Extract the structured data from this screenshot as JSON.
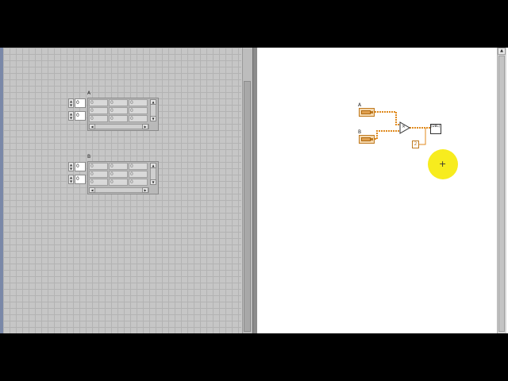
{
  "front_panel": {
    "arrays": [
      {
        "label": "A",
        "index_values": [
          "0",
          "0"
        ],
        "rows": [
          [
            "0",
            "0",
            "0"
          ],
          [
            "0",
            "0",
            "0"
          ],
          [
            "0",
            "0",
            "0"
          ]
        ]
      },
      {
        "label": "B",
        "index_values": [
          "0",
          "0"
        ],
        "rows": [
          [
            "0",
            "0",
            "0"
          ],
          [
            "0",
            "0",
            "0"
          ],
          [
            "0",
            "0",
            "0"
          ]
        ]
      }
    ]
  },
  "block_diagram": {
    "terminals": [
      {
        "label": "A"
      },
      {
        "label": "B"
      }
    ],
    "multiply_symbol": "×",
    "constant_value": "2",
    "indicator_text": "[DBL]"
  },
  "icons": {
    "spin_up": "▲",
    "spin_down": "▼",
    "scroll_left": "◀",
    "scroll_right": "▶",
    "scroll_up": "▲",
    "cursor": "+"
  },
  "colors": {
    "wire_orange": "#e08a1e",
    "cursor_highlight": "#f7ec1e"
  }
}
